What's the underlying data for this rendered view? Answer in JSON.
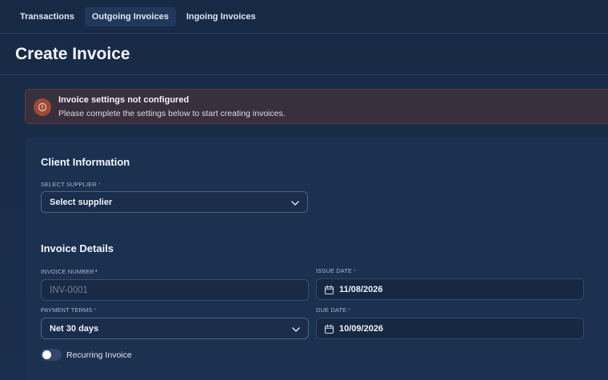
{
  "nav": {
    "tabs": [
      {
        "label": "Transactions"
      },
      {
        "label": "Outgoing Invoices"
      },
      {
        "label": "Ingoing Invoices"
      }
    ]
  },
  "page": {
    "title": "Create Invoice"
  },
  "alert": {
    "title": "Invoice settings not configured",
    "message": "Please complete the settings below to start creating invoices.",
    "icon": "warning-circle-icon",
    "color": "#9c4a36"
  },
  "client": {
    "title": "Client Information",
    "supplier_label": "SELECT SUPPLIER",
    "supplier_required": "*",
    "supplier_value": "Select supplier"
  },
  "details": {
    "title": "Invoice Details",
    "invoice_number_label": "INVOICE NUMBER",
    "invoice_number_required": "*",
    "invoice_number_placeholder": "INV-0001",
    "issue_date_label": "ISSUE DATE",
    "issue_date_required": "*",
    "issue_date_value": "11/08/2026",
    "payment_terms_label": "PAYMENT TERMS",
    "payment_terms_required": "*",
    "payment_terms_value": "Net 30 days",
    "due_date_label": "DUE DATE",
    "due_date_required": "*",
    "due_date_value": "10/09/2026",
    "recurring_label": "Recurring Invoice",
    "recurring_on": false
  },
  "colors": {
    "background": "#172a45",
    "accent_required": "#5b8ad6",
    "alert_bg": "#3a2f3d"
  }
}
